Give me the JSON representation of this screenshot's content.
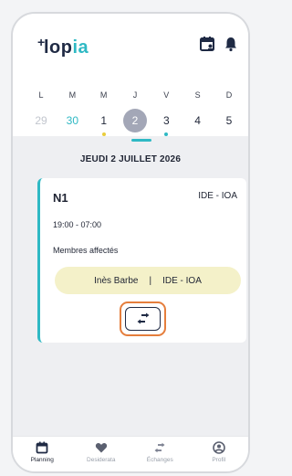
{
  "app": {
    "logo_prefix": "+",
    "logo_main": "lop",
    "logo_accent": "ia"
  },
  "header": {
    "calendar_icon": "calendar-user-icon",
    "bell_icon": "bell-icon"
  },
  "week": {
    "weekdays": [
      "L",
      "M",
      "M",
      "J",
      "V",
      "S",
      "D"
    ],
    "days": [
      {
        "num": "29",
        "style": "muted",
        "dot": ""
      },
      {
        "num": "30",
        "style": "accent",
        "dot": ""
      },
      {
        "num": "1",
        "style": "normal",
        "dot": "yellow"
      },
      {
        "num": "2",
        "style": "selected",
        "dot": ""
      },
      {
        "num": "3",
        "style": "normal",
        "dot": "teal"
      },
      {
        "num": "4",
        "style": "normal",
        "dot": ""
      },
      {
        "num": "5",
        "style": "normal",
        "dot": ""
      }
    ]
  },
  "day_title": "JEUDI 2 JUILLET 2026",
  "shift": {
    "code": "N1",
    "role": "IDE - IOA",
    "hours": "19:00 - 07:00",
    "members_title": "Membres affectés",
    "member_name": "Inès Barbe",
    "member_sep": "|",
    "member_role": "IDE - IOA",
    "swap_icon": "swap-arrows-icon"
  },
  "nav": {
    "items": [
      {
        "label": "Planning",
        "icon": "calendar-icon",
        "active": true
      },
      {
        "label": "Desiderata",
        "icon": "heart-icon",
        "active": false
      },
      {
        "label": "Échanges",
        "icon": "swap-icon",
        "active": false
      },
      {
        "label": "Profil",
        "icon": "user-icon",
        "active": false
      }
    ]
  },
  "colors": {
    "accent": "#2fb9c4",
    "dark": "#1f2a44",
    "highlight": "#e57e3c",
    "pill": "#f4f1c9"
  }
}
